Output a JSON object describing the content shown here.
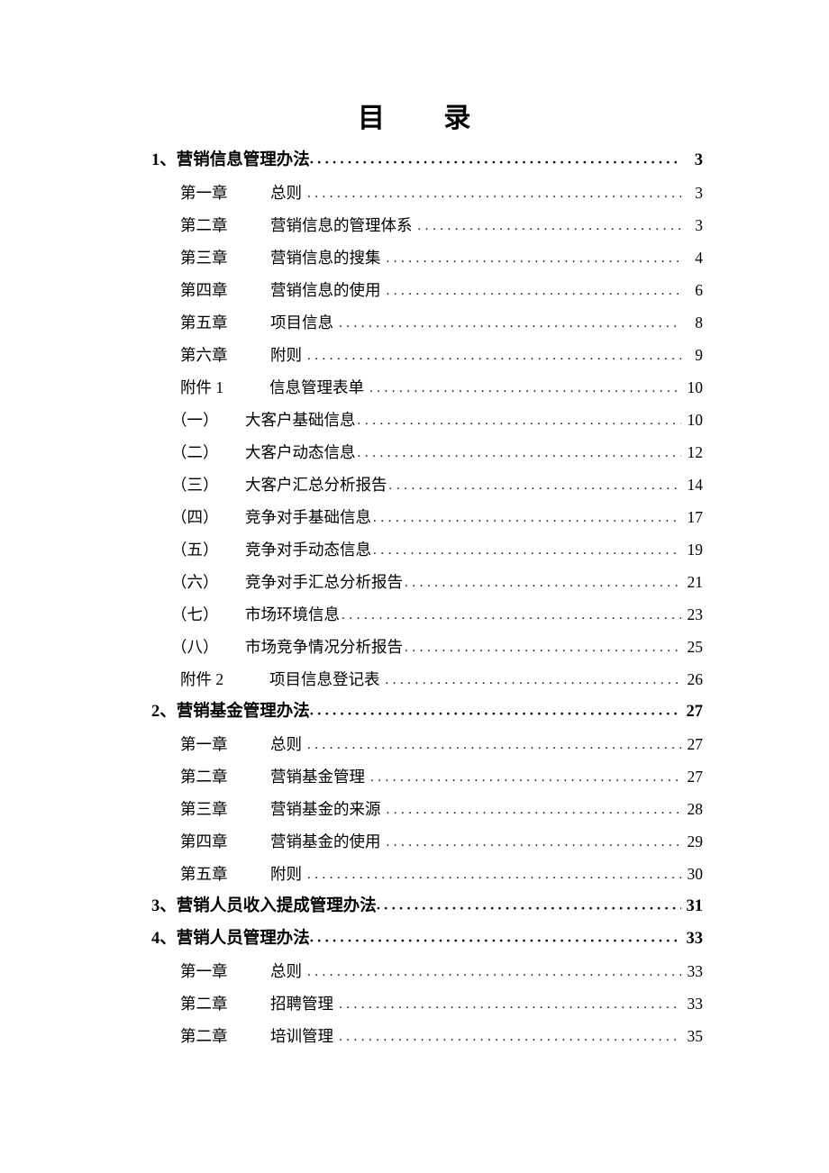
{
  "document": {
    "title": "目        录",
    "title_plain": "目 录"
  },
  "toc": {
    "entries": [
      {
        "level": "1",
        "label": "1、营销信息管理办法",
        "title": "",
        "page": "3"
      },
      {
        "level": "2",
        "label": "第一章",
        "title": "总则",
        "page": "3"
      },
      {
        "level": "2",
        "label": "第二章",
        "title": "营销信息的管理体系",
        "page": "3"
      },
      {
        "level": "2",
        "label": "第三章",
        "title": "营销信息的搜集",
        "page": "4"
      },
      {
        "level": "2",
        "label": "第四章",
        "title": "营销信息的使用",
        "page": "6"
      },
      {
        "level": "2",
        "label": "第五章",
        "title": "项目信息",
        "page": "8"
      },
      {
        "level": "2",
        "label": "第六章",
        "title": "附则",
        "page": "9"
      },
      {
        "level": "att",
        "label": "附件 1",
        "title": "信息管理表单",
        "page": "10"
      },
      {
        "level": "3",
        "label": "（一）",
        "title": "大客户基础信息",
        "page": "10"
      },
      {
        "level": "3",
        "label": "（二）",
        "title": "大客户动态信息",
        "page": "12"
      },
      {
        "level": "3",
        "label": "（三）",
        "title": "大客户汇总分析报告",
        "page": "14"
      },
      {
        "level": "3",
        "label": "（四）",
        "title": "竞争对手基础信息",
        "page": "17"
      },
      {
        "level": "3",
        "label": "（五）",
        "title": "竞争对手动态信息",
        "page": "19"
      },
      {
        "level": "3",
        "label": "（六）",
        "title": "竞争对手汇总分析报告",
        "page": "21"
      },
      {
        "level": "3",
        "label": "（七）",
        "title": "市场环境信息",
        "page": "23"
      },
      {
        "level": "3",
        "label": "（八）",
        "title": "市场竞争情况分析报告",
        "page": "25"
      },
      {
        "level": "att",
        "label": "附件 2",
        "title": "项目信息登记表",
        "page": "26"
      },
      {
        "level": "1",
        "label": "2、营销基金管理办法",
        "title": "",
        "page": "27"
      },
      {
        "level": "2",
        "label": "第一章",
        "title": "总则",
        "page": "27"
      },
      {
        "level": "2",
        "label": "第二章",
        "title": "营销基金管理",
        "page": "27"
      },
      {
        "level": "2",
        "label": "第三章",
        "title": "营销基金的来源",
        "page": "28"
      },
      {
        "level": "2",
        "label": "第四章",
        "title": "营销基金的使用",
        "page": "29"
      },
      {
        "level": "2",
        "label": "第五章",
        "title": "附则",
        "page": "30"
      },
      {
        "level": "1",
        "label": "3、营销人员收入提成管理办法",
        "title": "",
        "page": "31"
      },
      {
        "level": "1",
        "label": "4、营销人员管理办法",
        "title": "",
        "page": "33"
      },
      {
        "level": "2",
        "label": "第一章",
        "title": "总则",
        "page": "33"
      },
      {
        "level": "2",
        "label": "第二章",
        "title": "招聘管理",
        "page": "33"
      },
      {
        "level": "2",
        "label": "第二章",
        "title": "培训管理",
        "page": "35"
      }
    ]
  },
  "style": {
    "text_color": "#000000",
    "page_background": "#ffffff"
  }
}
